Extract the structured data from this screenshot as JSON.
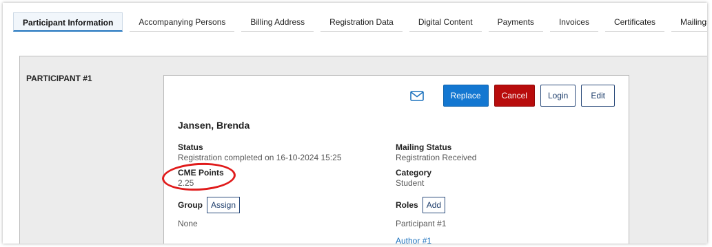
{
  "tabs": [
    {
      "label": "Participant Information",
      "active": true
    },
    {
      "label": "Accompanying Persons"
    },
    {
      "label": "Billing Address"
    },
    {
      "label": "Registration Data"
    },
    {
      "label": "Digital Content"
    },
    {
      "label": "Payments"
    },
    {
      "label": "Invoices"
    },
    {
      "label": "Certificates"
    },
    {
      "label": "Mailings"
    }
  ],
  "section": {
    "label": "PARTICIPANT #1"
  },
  "card": {
    "actions": {
      "mail_icon": "envelope-icon",
      "replace": "Replace",
      "cancel": "Cancel",
      "login": "Login",
      "edit": "Edit"
    },
    "name": "Jansen, Brenda",
    "status": {
      "label": "Status",
      "value": "Registration completed on 16-10-2024 15:25"
    },
    "mailing_status": {
      "label": "Mailing Status",
      "value": "Registration Received"
    },
    "cme_points": {
      "label": "CME Points",
      "value": "2.25"
    },
    "category": {
      "label": "Category",
      "value": "Student"
    },
    "group": {
      "label": "Group",
      "button": "Assign",
      "value": "None"
    },
    "roles": {
      "label": "Roles",
      "button": "Add",
      "items": [
        "Participant #1",
        "Author #1"
      ]
    }
  },
  "colors": {
    "primary": "#1377d1",
    "danger": "#b80c0c",
    "highlight": "#e01b1b"
  }
}
